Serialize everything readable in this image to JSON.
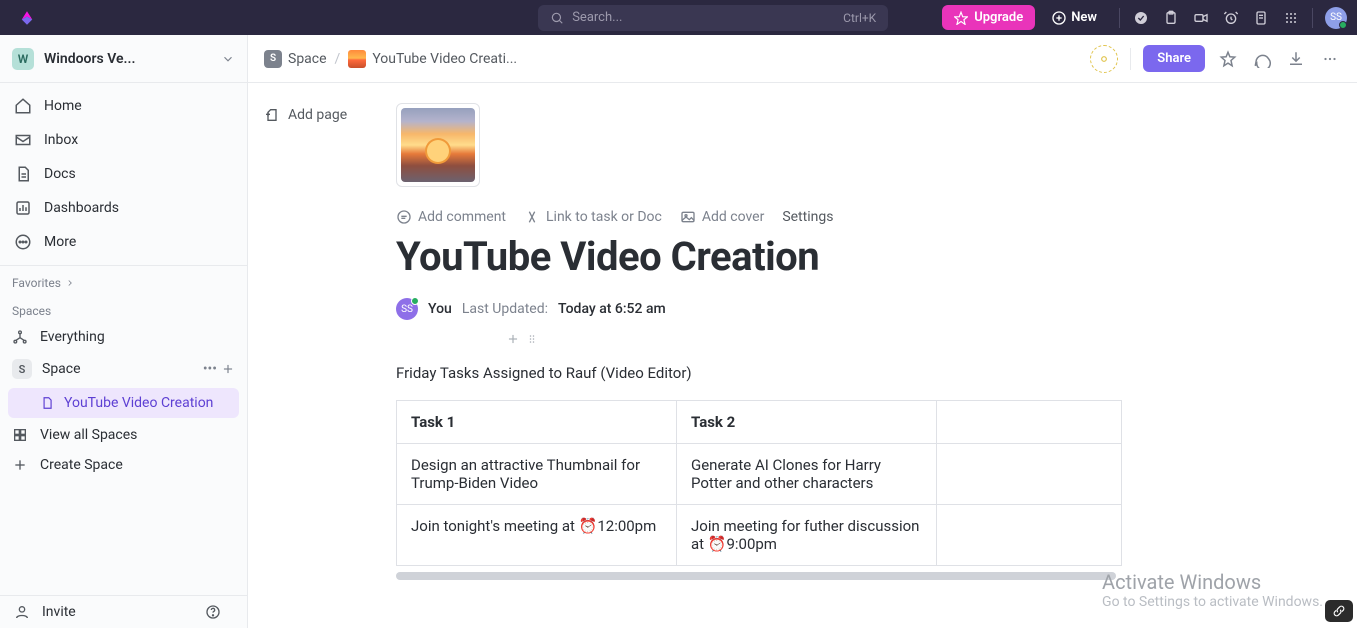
{
  "search": {
    "placeholder": "Search...",
    "shortcut": "Ctrl+K"
  },
  "topbar": {
    "upgrade": "Upgrade",
    "new": "New",
    "avatar_initials": "SS"
  },
  "workspace": {
    "badge": "W",
    "name": "Windoors Ve..."
  },
  "nav": {
    "home": "Home",
    "inbox": "Inbox",
    "docs": "Docs",
    "dashboards": "Dashboards",
    "more": "More"
  },
  "sections": {
    "favorites": "Favorites",
    "spaces": "Spaces"
  },
  "spacelist": {
    "everything": "Everything",
    "space_badge": "S",
    "space_label": "Space",
    "doc_item": "YouTube Video Creation",
    "view_all": "View all Spaces",
    "create": "Create Space"
  },
  "sidebar_bottom": {
    "invite": "Invite"
  },
  "breadcrumb": {
    "space_badge": "S",
    "space": "Space",
    "doc": "YouTube Video Creati..."
  },
  "header": {
    "share": "Share",
    "addpage": "Add page"
  },
  "actions": {
    "comment": "Add comment",
    "link": "Link to task or Doc",
    "cover": "Add cover",
    "settings": "Settings"
  },
  "doc": {
    "title": "YouTube Video Creation",
    "author_initials": "SS",
    "author_label": "You",
    "last_updated_label": "Last Updated:",
    "last_updated_value": "Today at 6:52 am",
    "paragraph": "Friday Tasks Assigned to Rauf (Video Editor)"
  },
  "table": {
    "headers": [
      "Task 1",
      "Task 2",
      ""
    ],
    "rows": [
      [
        "Design an attractive Thumbnail for Trump-Biden Video",
        "Generate AI Clones for Harry Potter and other characters",
        ""
      ],
      [
        "Join tonight's meeting at ⏰12:00pm",
        "Join meeting for futher discussion at ⏰9:00pm",
        ""
      ]
    ]
  },
  "watermark": {
    "line1": "Activate Windows",
    "line2": "Go to Settings to activate Windows."
  }
}
